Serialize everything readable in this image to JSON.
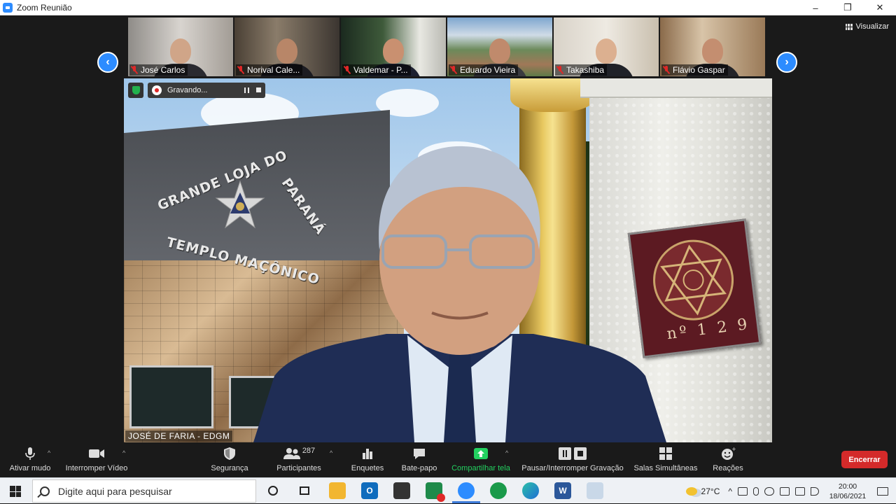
{
  "window": {
    "title": "Zoom Reunião",
    "controls": [
      "–",
      "❐",
      "✕"
    ]
  },
  "view_button": {
    "label": "Visualizar"
  },
  "participants_strip": [
    {
      "name": "José Carlos",
      "muted": true
    },
    {
      "name": "Norival Cale...",
      "muted": true
    },
    {
      "name": "Valdemar - P...",
      "muted": true
    },
    {
      "name": "Eduardo Vieira",
      "muted": true
    },
    {
      "name": "Takashiba",
      "muted": true
    },
    {
      "name": "Flávio Gaspar",
      "muted": true
    }
  ],
  "active_speaker": {
    "name": "JOSÉ DE FARIA - EDGM",
    "background_text": {
      "arc": "GRANDE LOJA DO",
      "arc2": "PARANÁ",
      "building": "TEMPLO MAÇÔNICO",
      "plaque_number": "nº 1 2 9"
    }
  },
  "recording": {
    "label": "Gravando..."
  },
  "toolbar": {
    "mute": "Ativar mudo",
    "video": "Interromper Vídeo",
    "security": "Segurança",
    "participants": "Participantes",
    "participant_count": "287",
    "polls": "Enquetes",
    "chat": "Bate-papo",
    "share": "Compartilhar tela",
    "recording": "Pausar/Interromper Gravação",
    "breakout": "Salas Simultâneas",
    "reactions": "Reações",
    "end": "Encerrar"
  },
  "taskbar": {
    "search_placeholder": "Digite aqui para pesquisar",
    "temperature": "27°C",
    "time": "20:00",
    "date": "18/06/2021"
  },
  "colors": {
    "zoom_blue": "#2d8cff",
    "end_red": "#d42a2a",
    "share_green": "#23d160",
    "mute_red": "#e02828"
  }
}
